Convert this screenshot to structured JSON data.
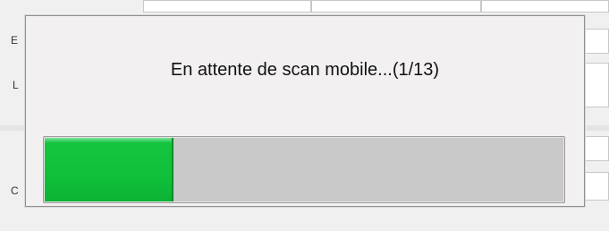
{
  "background": {
    "partial_letters": [
      "E",
      "L",
      "C"
    ]
  },
  "dialog": {
    "message": "En attente de scan mobile...(1/13)",
    "progress": {
      "fraction": 0.2448
    },
    "colors": {
      "progress_fill": "#10c23c",
      "progress_track": "#c9c9c9",
      "dialog_bg": "#f2f0f1"
    }
  }
}
